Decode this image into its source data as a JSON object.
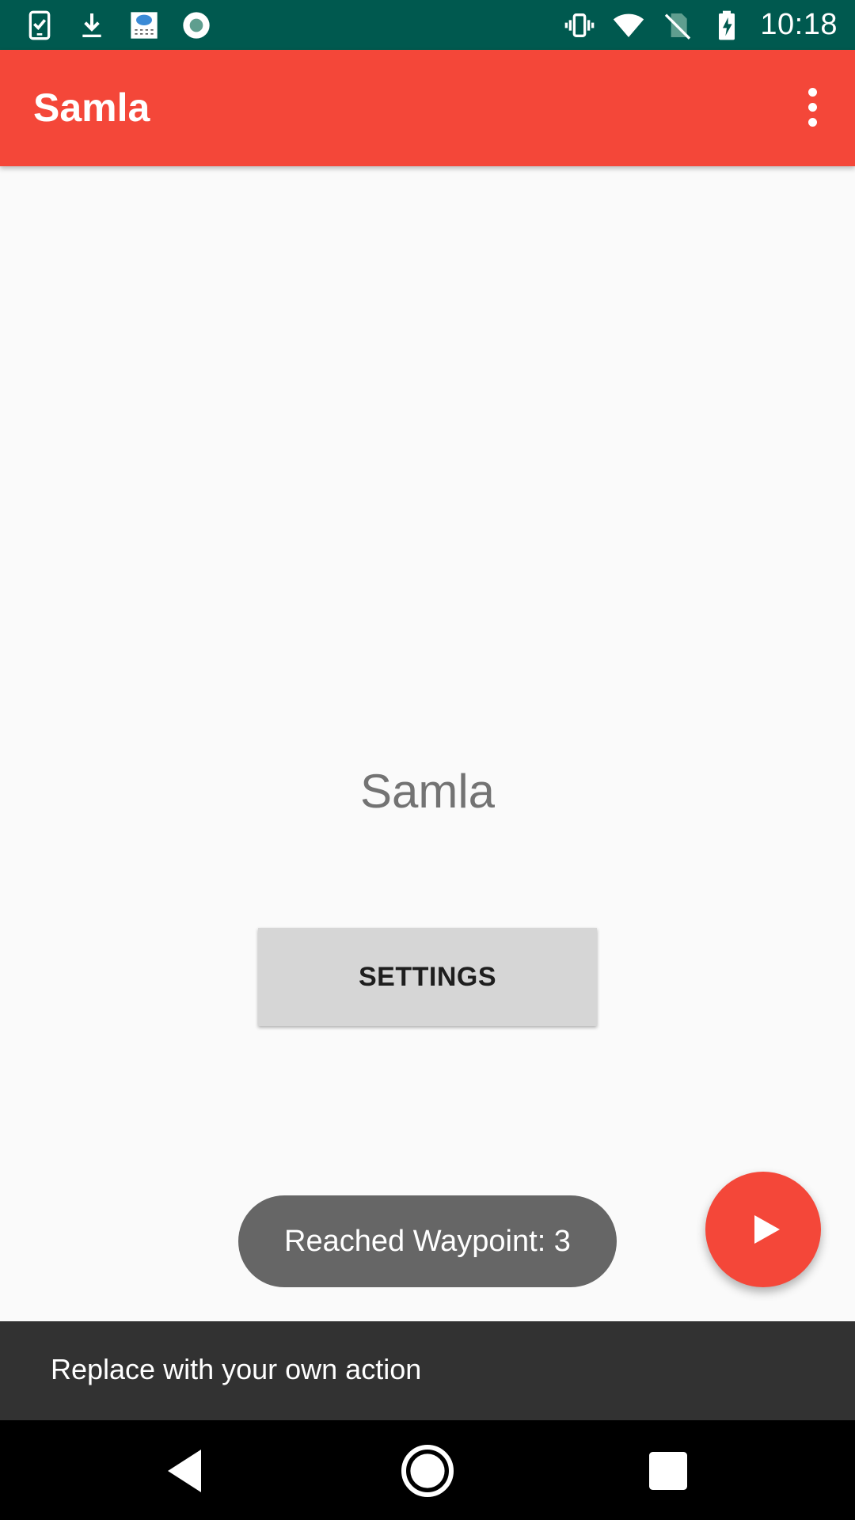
{
  "status_bar": {
    "time": "10:18",
    "left_icons": [
      "task-check-icon",
      "download-icon",
      "weather-test-icon",
      "record-circle-icon"
    ],
    "right_icons": [
      "vibrate-icon",
      "wifi-icon",
      "no-sim-icon",
      "battery-charging-icon"
    ],
    "background_color": "#00594f"
  },
  "app_bar": {
    "title": "Samla",
    "overflow_icon": "more-vert-icon",
    "background_color": "#f44739"
  },
  "main": {
    "title": "Samla",
    "settings_button_label": "SETTINGS"
  },
  "toast": {
    "text": "Reached Waypoint: 3"
  },
  "fab": {
    "icon": "play-icon",
    "color": "#f44739"
  },
  "snackbar": {
    "text": "Replace with your own action"
  },
  "nav_bar": {
    "buttons": [
      "back-icon",
      "home-icon",
      "recents-icon"
    ]
  }
}
